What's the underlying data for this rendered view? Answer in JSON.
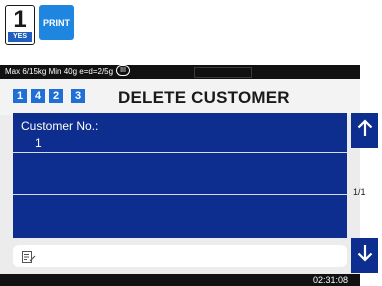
{
  "top_icons": {
    "key_number": "1",
    "key_sub": "YES",
    "print_label": "PRINT"
  },
  "status": {
    "scale_info": "Max 6/15kg Min 40g e=d=2/5g",
    "accuracy_class": "III"
  },
  "header": {
    "breadcrumb": [
      "1",
      "4",
      "2",
      "3"
    ],
    "title": "DELETE CUSTOMER"
  },
  "form": {
    "fields": [
      {
        "label": "Customer No.:",
        "value": "1"
      },
      {
        "label": "",
        "value": ""
      },
      {
        "label": "",
        "value": ""
      }
    ]
  },
  "pagination": {
    "indicator": "1/1"
  },
  "clock": "02:31:08",
  "colors": {
    "panel": "#0d2e8e",
    "accent": "#1f6fd6",
    "print_icon": "#1f86e0",
    "status_bar": "#111111"
  },
  "icons": {
    "scroll_up": "arrow-up-icon",
    "scroll_down": "arrow-down-icon",
    "input": "edit-icon"
  }
}
